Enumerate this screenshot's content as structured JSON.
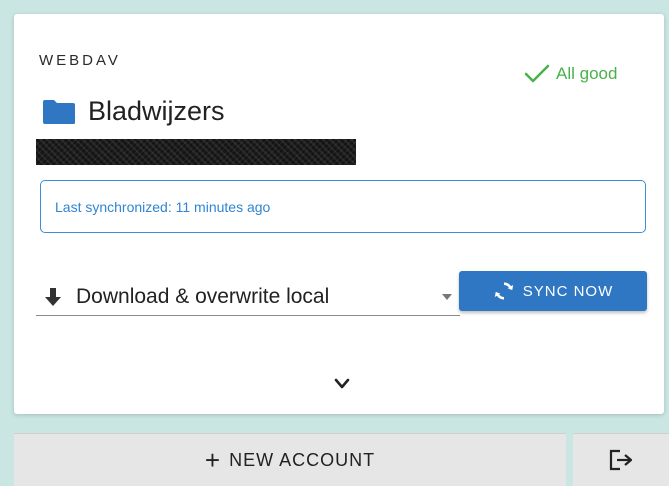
{
  "account": {
    "type_label": "WEBDAV",
    "title": "Bladwijzers",
    "status_text": "All good",
    "last_sync_text": "Last synchronized: 11 minutes ago",
    "strategy_label": "Download & overwrite local",
    "sync_button_label": "SYNC NOW"
  },
  "footer": {
    "new_account_label": "NEW ACCOUNT"
  },
  "colors": {
    "status_ok": "#48b24a",
    "accent_blue": "#2f77c2",
    "info_border": "#3a8fd6",
    "background": "#c9e6e3"
  },
  "icons": {
    "status": "check-icon",
    "folder": "folder-icon",
    "strategy": "arrow-down-icon",
    "sync": "sync-icon",
    "expand": "chevron-down-icon",
    "new_account": "plus-icon",
    "logout": "logout-icon"
  }
}
